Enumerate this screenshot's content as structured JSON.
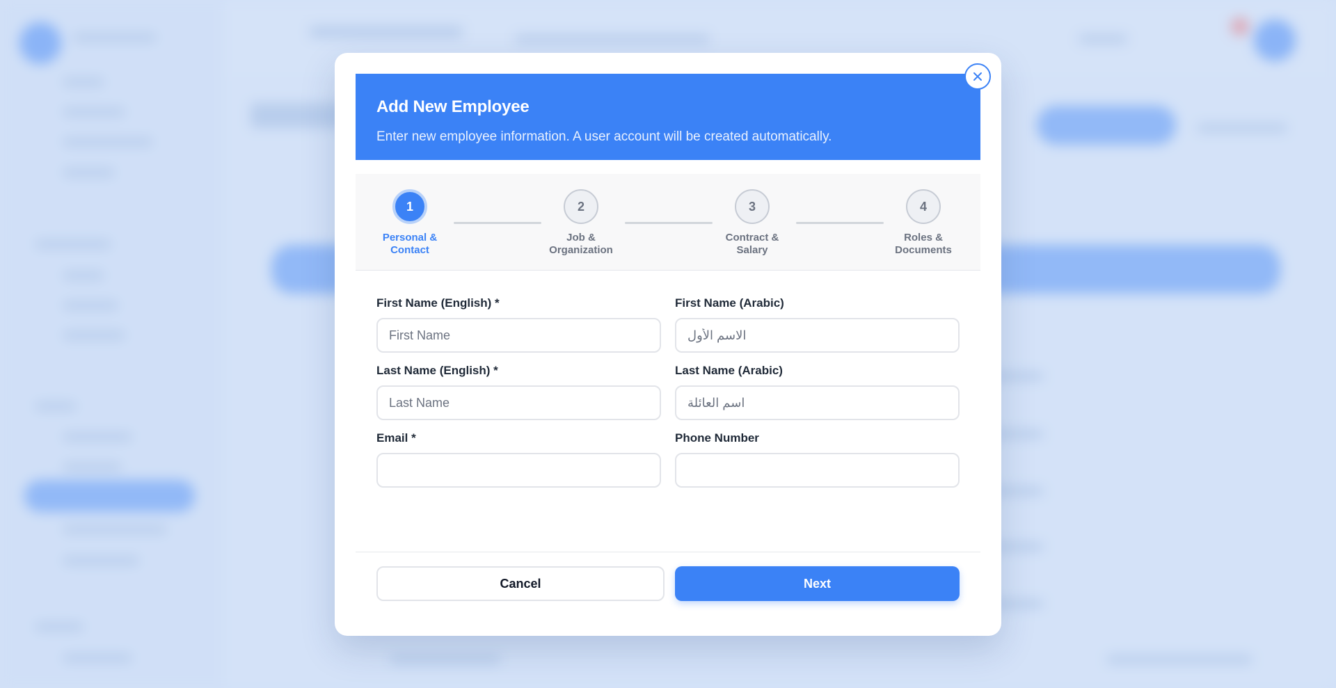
{
  "theme": {
    "accent": "#3b82f6",
    "overlay": "#d6e3f7"
  },
  "dialog": {
    "title": "Add New Employee",
    "subtitle": "Enter new employee information. A user account will be created automatically.",
    "close_icon": "close-icon"
  },
  "stepper": {
    "current_step": 1,
    "steps": [
      {
        "number": "1",
        "label": "Personal & Contact"
      },
      {
        "number": "2",
        "label": "Job & Organization"
      },
      {
        "number": "3",
        "label": "Contract & Salary"
      },
      {
        "number": "4",
        "label": "Roles & Documents"
      }
    ]
  },
  "form": {
    "first_name_en": {
      "label": "First Name (English) *",
      "placeholder": "First Name",
      "value": ""
    },
    "first_name_ar": {
      "label": "First Name (Arabic)",
      "placeholder": "الاسم الأول",
      "value": ""
    },
    "last_name_en": {
      "label": "Last Name (English) *",
      "placeholder": "Last Name",
      "value": ""
    },
    "last_name_ar": {
      "label": "Last Name (Arabic)",
      "placeholder": "اسم العائلة",
      "value": ""
    },
    "email": {
      "label": "Email *",
      "placeholder": "",
      "value": ""
    },
    "phone": {
      "label": "Phone Number",
      "placeholder": "",
      "value": ""
    }
  },
  "footer": {
    "cancel_label": "Cancel",
    "next_label": "Next"
  }
}
